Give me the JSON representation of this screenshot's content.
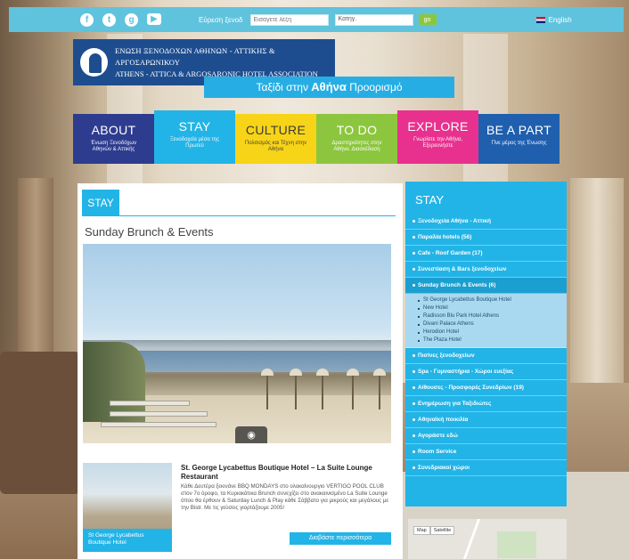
{
  "topbar": {
    "social": [
      {
        "icon": "facebook-icon",
        "glyph": "f"
      },
      {
        "icon": "twitter-icon",
        "glyph": "t"
      },
      {
        "icon": "googleplus-icon",
        "glyph": "g"
      },
      {
        "icon": "youtube-icon",
        "glyph": "▶"
      }
    ],
    "search_label": "Εύρεση ξενοδ",
    "search_placeholder": "Εισάγετε λέξη",
    "category_value": "Κατηγ.",
    "search_button": "go",
    "language": "English"
  },
  "logo": {
    "line1": "ΕΝΩΣΗ ΞΕΝΟΔΟΧΩΝ ΑΘΗΝΩΝ - ΑΤΤΙΚΗΣ & ΑΡΓΟΣΑΡΩΝΙΚΟΥ",
    "line2": "ATHENS - ATTICA & ARGOSARONIC HOTEL ASSOCIATION"
  },
  "tagline": {
    "part1": "Ταξίδι",
    "part2": " στην ",
    "part3": "Αθήνα",
    "part4": " Προορισμό"
  },
  "menu": [
    {
      "key": "about",
      "title": "ABOUT",
      "subtitle": "Ένωση Ξενοδόχων Αθηνών & Αττικής"
    },
    {
      "key": "stay",
      "title": "STAY",
      "subtitle": "Ξενοδοχεία μέσα της Πρωτεύ"
    },
    {
      "key": "culture",
      "title": "CULTURE",
      "subtitle": "Πολιτισμός και Τέχνη στην Αθήνα"
    },
    {
      "key": "todo",
      "title": "TO DO",
      "subtitle": "Δραστηριότητες στην Αθήνα. Διασκέδαση"
    },
    {
      "key": "explore",
      "title": "EXPLORE",
      "subtitle": "Γνωρίστε την Αθήνα, Εξερευνήστε"
    },
    {
      "key": "bepart",
      "title": "BE A PART",
      "subtitle": "Γίνε μέρος της Ένωσης"
    }
  ],
  "content": {
    "section_tag": "STAY",
    "heading": "Sunday Brunch & Events",
    "listing": {
      "title": "St. George Lycabettus Boutique Hotel – La Suite Lounge Restaurant",
      "description": "Κάθε Δευτέρα ξεκινάνε BBQ MONDAYS στο ολοκαίνουργιο VERTIGO POOL CLUB στον 7ο όροφο, τα Κυριακάτικα Brunch συνεχίζει στο ανακαινισμένο La Suite Lounge όπου θα έρθουν & Saturday Lunch & Play κάθε Σάββατο για μικρούς και μεγάλους με την Bistr. Με τις γεύσεις γιορτάζουμε 2005!",
      "thumb_caption": "St George Lycabettus Boutique Hotel",
      "more_button": "Διαβάστε περισσότερα"
    }
  },
  "sidebar": {
    "title": "STAY",
    "items_before": [
      "Ξενοδοχεία Αθήνα - Αττική",
      "Παραλία hotels (56)",
      "Cafe - Roof Garden (17)",
      "Συνεστίαση & Bars ξενοδοχείων"
    ],
    "active_item": "Sunday Brunch & Events (6)",
    "subitems": [
      "St George Lycabettus Boutique Hotel",
      "New Hotel",
      "Radisson Blu Park Hotel Athens",
      "Divani Palace Athens",
      "Herodion Hotel",
      "The Plaza Hotel"
    ],
    "items_after": [
      "Πισίνες ξενοδοχείων",
      "Spa - Γυμναστήρια - Χώροι ευεξίας",
      "Αίθουσες - Προσφορές Συνεδρίων (19)",
      "Ενημέρωση για Ταξιδιώτες",
      "Αθηναϊκή ποικιλία",
      "Αγοράστε εδώ",
      "Room Service",
      "Συνεδριακοί χώροι"
    ]
  },
  "map": {
    "tab_map": "Map",
    "tab_satellite": "Satellite"
  }
}
